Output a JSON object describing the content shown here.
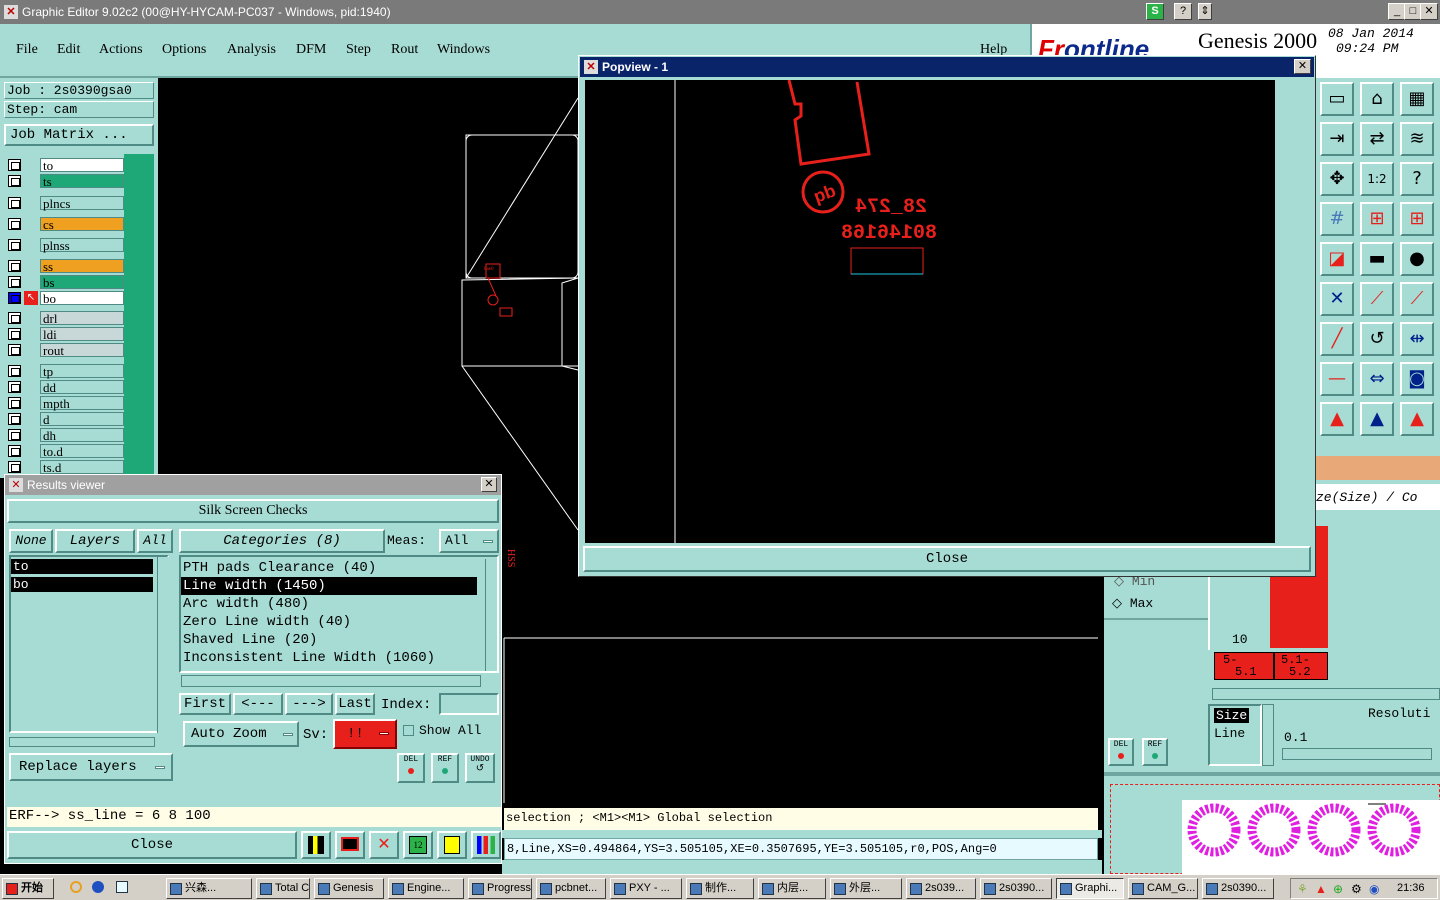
{
  "window": {
    "title": "Graphic Editor 9.02c2 (00@HY-HYCAM-PC037 - Windows, pid:1940)"
  },
  "menubar": {
    "items": [
      "File",
      "Edit",
      "Actions",
      "Options",
      "Analysis",
      "DFM",
      "Step",
      "Rout",
      "Windows"
    ],
    "help": "Help"
  },
  "brand": {
    "logo_a": "Fr",
    "logo_b": "ontline",
    "product": "Genesis 2000",
    "date": "08 Jan 2014",
    "time": "09:24 PM"
  },
  "job": {
    "job_label": "Job : 2s0390gsa0",
    "step_label": "Step: cam",
    "matrix_button": "Job Matrix ..."
  },
  "layers": [
    {
      "name": "to",
      "color": "#ffffff",
      "mark": "↗"
    },
    {
      "name": "ts",
      "color": "#1ea878",
      "mark": "↗"
    },
    {
      "name": "plncs",
      "color": "#a6dcd4",
      "mark": ""
    },
    {
      "name": "cs",
      "color": "#f0a020",
      "mark": "↗"
    },
    {
      "name": "plnss",
      "color": "#a6dcd4",
      "mark": ""
    },
    {
      "name": "ss",
      "color": "#f0a020",
      "mark": "↗"
    },
    {
      "name": "bs",
      "color": "#1ea878",
      "mark": "↗"
    },
    {
      "name": "bo",
      "color": "#ffffff",
      "mark": "↗□"
    },
    {
      "name": "drl",
      "color": "#c8d8d8",
      "mark": ""
    },
    {
      "name": "ldi",
      "color": "#c8d8d8",
      "mark": ""
    },
    {
      "name": "rout",
      "color": "#c8d8d8",
      "mark": ""
    },
    {
      "name": "tp",
      "color": "#a6dcd4",
      "mark": ""
    },
    {
      "name": "dd",
      "color": "#a6dcd4",
      "mark": "↗"
    },
    {
      "name": "mpth",
      "color": "#a6dcd4",
      "mark": ""
    },
    {
      "name": "d",
      "color": "#a6dcd4",
      "mark": ""
    },
    {
      "name": "dh",
      "color": "#a6dcd4",
      "mark": ""
    },
    {
      "name": "to.d",
      "color": "#a6dcd4",
      "mark": "↗"
    },
    {
      "name": "ts.d",
      "color": "#a6dcd4",
      "mark": "↗"
    }
  ],
  "results_viewer": {
    "title": "Results viewer",
    "header": "Silk Screen Checks",
    "none_btn": "None",
    "layers_btn": "Layers",
    "all_btn": "All",
    "categories_btn": "Categories (8)",
    "meas_label": "Meas:",
    "meas_value": "All",
    "layer_list": [
      "to",
      "bo"
    ],
    "categories": [
      "PTH pads Clearance (40)",
      "Line width (1450)",
      "Arc width (480)",
      "Zero Line width (40)",
      "Shaved Line (20)",
      "Inconsistent Line Width (1060)"
    ],
    "selected_category": 1,
    "first_btn": "First",
    "prev_btn": "<---",
    "next_btn": "--->",
    "last_btn": "Last",
    "index_label": "Index:",
    "index_value": "",
    "auto_zoom": "Auto Zoom",
    "sv_label": "Sv:",
    "sv_value": "!!",
    "show_all": "Show All",
    "replace_layers": "Replace layers",
    "del_btn": "DEL",
    "ref_btn": "REF",
    "undo_btn": "UNDO",
    "erf_line": "ERF--> ss_line = 6 8 100",
    "close_btn": "Close"
  },
  "popview": {
    "title": "Popview - 1",
    "text_line1": "28_274",
    "text_line2": "80146168",
    "pb_label": "pb",
    "close_btn": "Close"
  },
  "status": {
    "line1": "selection ; <M1><M1> Global selection",
    "line2": "8,Line,XS=0.494864,YS=3.505105,XE=0.3507695,YE=3.505105,r0,POS,Ang=0"
  },
  "right_panel": {
    "histogram_label": "ze(Size) / Co",
    "min_label": "Min",
    "max_label": "Max",
    "axis_val": "10",
    "bin_a": "5-",
    "bin_a2": "5.1",
    "bin_b": "5.1-",
    "bin_b2": "5.2",
    "size_tab": "Size",
    "line_tab": "Line",
    "resolution_label": "Resoluti",
    "resolution_value": "0.1",
    "del_btn": "DEL",
    "ref_btn": "REF"
  },
  "taskbar": {
    "start": "开始",
    "tasks": [
      "兴森...",
      "Total C...",
      "Genesis",
      "Engine...",
      "Progress",
      "pcbnet...",
      "PXY - ...",
      "制作...",
      "内层...",
      "外层...",
      "2s039...",
      "2s0390...",
      "Graphi...",
      "CAM_G...",
      "2s0390..."
    ],
    "clock": "21:36"
  },
  "colors": {
    "panel": "#a6dcd4",
    "red": "#e8201c",
    "magenta": "#e020e0"
  }
}
